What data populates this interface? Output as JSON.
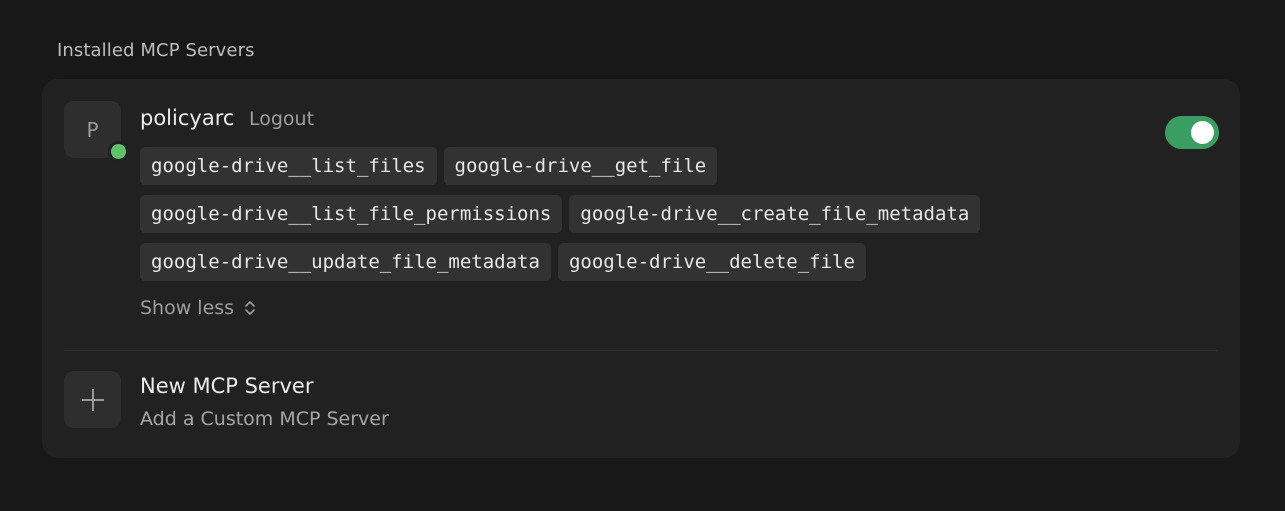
{
  "section": {
    "title": "Installed MCP Servers"
  },
  "server": {
    "avatar_letter": "P",
    "name": "policyarc",
    "logout_label": "Logout",
    "enabled": true,
    "status_color": "#5ec26a",
    "toggle_color": "#3a9d62",
    "tools": [
      [
        "google-drive__list_files",
        "google-drive__get_file"
      ],
      [
        "google-drive__list_file_permissions",
        "google-drive__create_file_metadata"
      ],
      [
        "google-drive__update_file_metadata",
        "google-drive__delete_file"
      ]
    ],
    "show_less_label": "Show less",
    "show_less_icon": "chevron-up-down-icon"
  },
  "new_server": {
    "icon": "plus-icon",
    "title": "New MCP Server",
    "subtitle": "Add a Custom MCP Server"
  }
}
